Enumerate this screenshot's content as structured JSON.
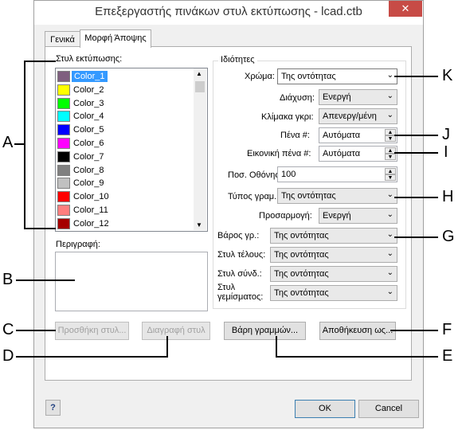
{
  "window": {
    "title": "Επεξεργαστής πινάκων στυλ εκτύπωσης - lcad.ctb",
    "close_label": "✕"
  },
  "tabs": [
    {
      "label": "Γενικά"
    },
    {
      "label": "Μορφή Άποψης"
    }
  ],
  "styles_label": "Στυλ εκτύπωσης:",
  "styles": [
    {
      "name": "Color_1",
      "color": "#7f5f7f"
    },
    {
      "name": "Color_2",
      "color": "#ffff00"
    },
    {
      "name": "Color_3",
      "color": "#00ff00"
    },
    {
      "name": "Color_4",
      "color": "#00ffff"
    },
    {
      "name": "Color_5",
      "color": "#0000ff"
    },
    {
      "name": "Color_6",
      "color": "#ff00ff"
    },
    {
      "name": "Color_7",
      "color": "#000000"
    },
    {
      "name": "Color_8",
      "color": "#808080"
    },
    {
      "name": "Color_9",
      "color": "#c0c0c0"
    },
    {
      "name": "Color_10",
      "color": "#ff0000"
    },
    {
      "name": "Color_11",
      "color": "#ff7f7f"
    },
    {
      "name": "Color_12",
      "color": "#a50000"
    }
  ],
  "description_label": "Περιγραφή:",
  "properties": {
    "group_label": "Ιδιότητες",
    "color_label": "Χρώμα:",
    "color_value": "Της οντότητας",
    "dither_label": "Διάχυση:",
    "dither_value": "Ενεργή",
    "grayscale_label": "Κλίμακα γκρι:",
    "grayscale_value": "Απενεργ/μένη",
    "pen_label": "Πένα #:",
    "pen_value": "Αυτόματα",
    "virtual_pen_label": "Εικονική πένα #:",
    "virtual_pen_value": "Αυτόματα",
    "screening_label": "Ποσ. Οθόνης:",
    "screening_value": "100",
    "linetype_label": "Τύπος γραμ.:",
    "linetype_value": "Της οντότητας",
    "adaptive_label": "Προσαρμογή:",
    "adaptive_value": "Ενεργή",
    "lineweight_label": "Βάρος γρ.:",
    "lineweight_value": "Της οντότητας",
    "endstyle_label": "Στυλ τέλους:",
    "endstyle_value": "Της οντότητας",
    "joinstyle_label": "Στυλ σύνδ.:",
    "joinstyle_value": "Της οντότητας",
    "fillstyle_label_1": "Στυλ",
    "fillstyle_label_2": "γεμίσματος:",
    "fillstyle_value": "Της οντότητας"
  },
  "buttons": {
    "add_style": "Προσθήκη στυλ...",
    "delete_style": "Διαγραφή στυλ",
    "lineweights": "Βάρη γραμμών...",
    "save_as": "Αποθήκευση ως...",
    "help": "?",
    "ok": "OK",
    "cancel": "Cancel"
  },
  "callouts": {
    "A": "A",
    "B": "B",
    "C": "C",
    "D": "D",
    "E": "E",
    "F": "F",
    "G": "G",
    "H": "H",
    "I": "I",
    "J": "J",
    "K": "K"
  }
}
